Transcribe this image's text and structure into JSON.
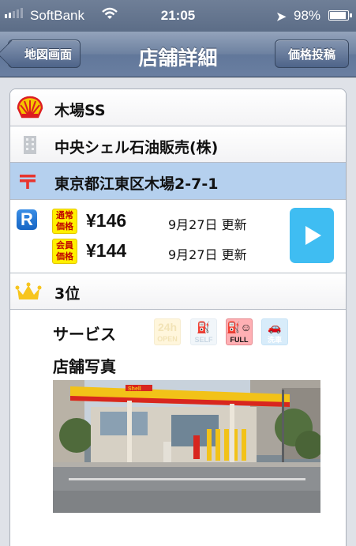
{
  "status_bar": {
    "carrier": "SoftBank",
    "time": "21:05",
    "battery": "98%"
  },
  "nav": {
    "back_label": "地図画面",
    "title": "店舗詳細",
    "action_label": "価格投稿"
  },
  "station": {
    "name": "木場SS",
    "company": "中央シェル石油販売(株)",
    "address": "東京都江東区木場2-7-1",
    "price_type_icon": "R",
    "regular_badge": "通常価格",
    "regular_badge_line1": "通常",
    "regular_badge_line2": "価格",
    "regular_price": "¥146",
    "regular_updated": "9月27日 更新",
    "member_badge": "会員価格",
    "member_badge_line1": "会員",
    "member_badge_line2": "価格",
    "member_price": "¥144",
    "member_updated": "9月27日 更新",
    "rank": "3位"
  },
  "details": {
    "services_label": "サービス",
    "photo_label": "店舗写真",
    "services": [
      {
        "name": "24h",
        "sub": "OPEN",
        "active": false
      },
      {
        "name": "SELF",
        "active": false
      },
      {
        "name": "FULL",
        "active": true
      },
      {
        "name": "洗車",
        "active": false
      }
    ]
  },
  "colors": {
    "selected_row": "#b5d0ee",
    "play_button": "#3fbdf2",
    "price_badge": "#fff000",
    "nav_bar": "#6d81a0"
  }
}
